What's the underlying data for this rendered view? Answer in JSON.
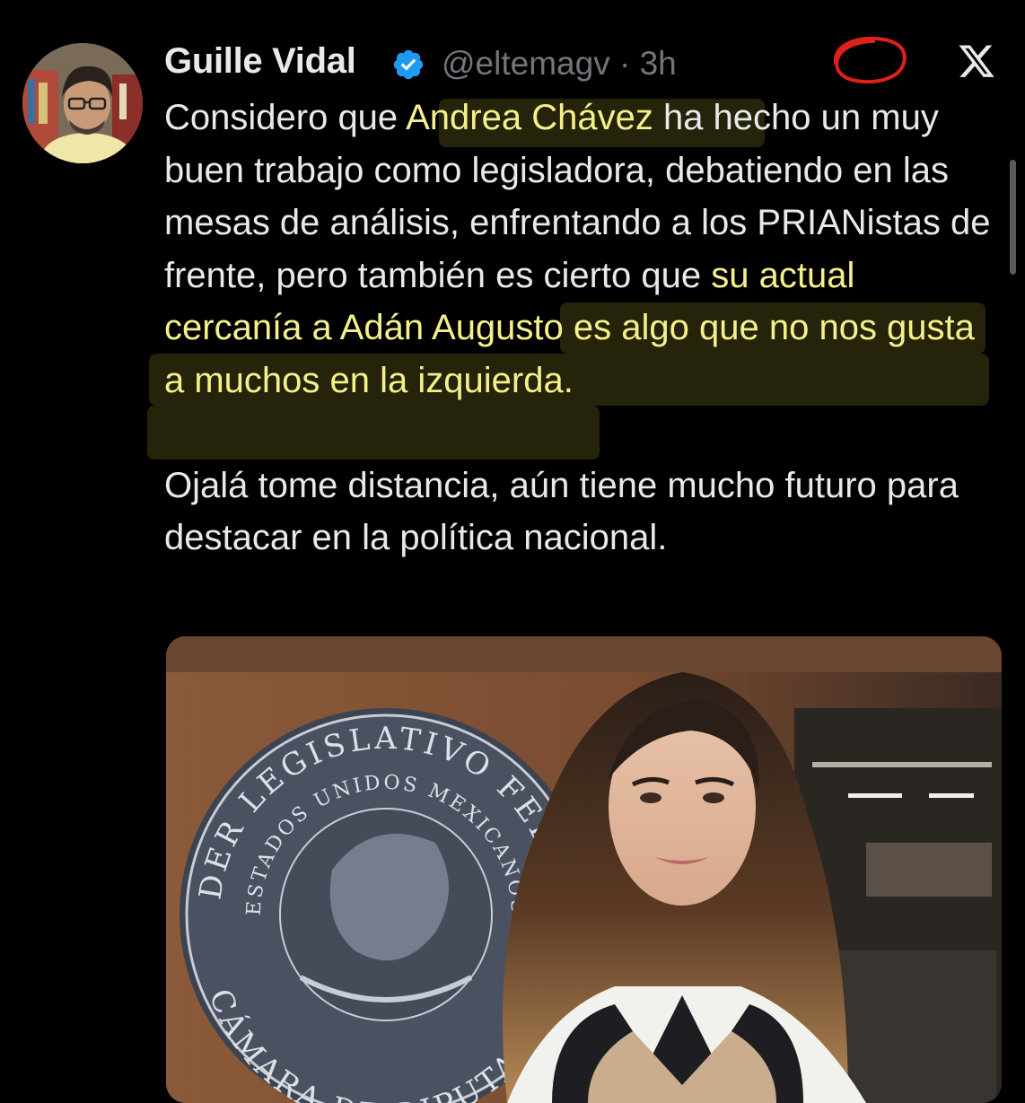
{
  "author": {
    "name": "Guille Vidal",
    "handle": "@eltemagv",
    "separator": "·",
    "time": "3h"
  },
  "tweet": {
    "p1_before": "Considero que ",
    "p1_hl1": "Andrea Chávez",
    "p1_mid": " ha hecho un muy buen trabajo como legisladora, debatiendo en las mesas de análisis, enfrentando a los PRIANistas de frente, pero también es cierto que ",
    "p1_hl2": "su actual cercanía a Adán Augusto es algo que no nos gusta a muchos en la izquierda.",
    "p2": "Ojalá tome distancia, aún tiene mucho futuro para destacar en la política nacional."
  },
  "media": {
    "seal_top": "PODER LEGISLATIVO FEDERAL",
    "seal_inner": "ESTADOS UNIDOS MEXICANOS",
    "seal_bottom": "CÁMARA DE DIPUTADOS"
  },
  "colors": {
    "background": "#000000",
    "text": "#e7e9ea",
    "muted": "#71767b",
    "verified": "#1d9bf0",
    "highlight": "#f5f08a",
    "annotation": "#e0201b"
  },
  "icons": [
    "verified-badge-icon",
    "x-logo-icon"
  ]
}
